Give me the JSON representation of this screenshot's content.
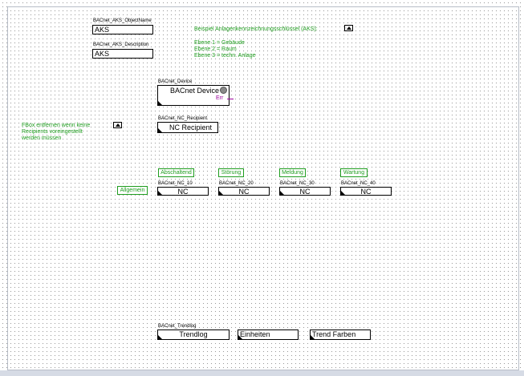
{
  "aks": {
    "objectname_label": "BACnet_AKS_ObjectName",
    "objectname_value": "AKS",
    "description_label": "BACnet_AKS_Description",
    "description_value": "AKS"
  },
  "info": {
    "title": "Beispiel Anlagenkennzeichnungsschlüssel (AKS):",
    "line1": "Ebene 1 = Gebäude",
    "line2": "Ebene 2 = Raum",
    "line3": "Ebene 3 = techn. Anlage"
  },
  "device": {
    "label": "BACnet_Device",
    "value": "BACnet Device",
    "err": "Err"
  },
  "recipient": {
    "label": "BACnet_NC_Recipient",
    "value": "NC Recipient"
  },
  "fbox_note": {
    "line1": "FBox entfernen wenn keine",
    "line2": "Recipients voreingestellt",
    "line3": "werden müssen"
  },
  "nc_row": {
    "tag_general": "Allgemein",
    "items": [
      {
        "tag": "Abschaltend",
        "label": "BACnet_NC_10",
        "value": "NC"
      },
      {
        "tag": "Störung",
        "label": "BACnet_NC_20",
        "value": "NC"
      },
      {
        "tag": "Meldung",
        "label": "BACnet_NC_30",
        "value": "NC"
      },
      {
        "tag": "Wartung",
        "label": "BACnet_NC_40",
        "value": "NC"
      }
    ]
  },
  "trendlog": {
    "label": "BACnet_Trendlog",
    "value": "Trendlog",
    "units_value": "Einheiten",
    "colors_value": "Trend Farben"
  },
  "colors": {
    "comment_green": "#1f9d1f",
    "err_magenta": "#9b009b"
  }
}
